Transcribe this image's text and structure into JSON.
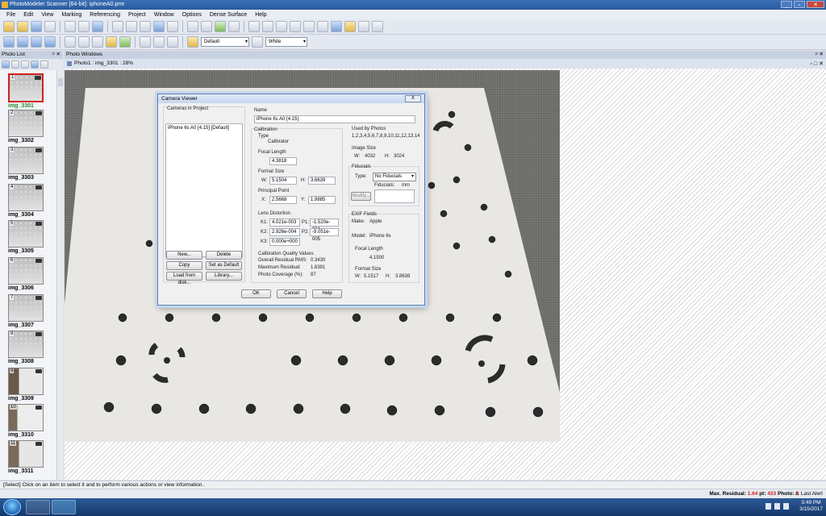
{
  "window": {
    "title": "PhotoModeler Scanner [64-bit]: iphoneA0.pmr",
    "buttons": [
      "_",
      "▫",
      "✕"
    ]
  },
  "menu": [
    "File",
    "Edit",
    "View",
    "Marking",
    "Referencing",
    "Project",
    "Window",
    "Options",
    "Dense Surface",
    "Help"
  ],
  "toolbar": {
    "display_select": "Default",
    "color_select": "White"
  },
  "photo_list": {
    "header": "Photo List",
    "items": [
      {
        "num": "1",
        "label": "img_3301",
        "selected": true
      },
      {
        "num": "2",
        "label": "img_3302"
      },
      {
        "num": "3",
        "label": "img_3303"
      },
      {
        "num": "4",
        "label": "img_3304"
      },
      {
        "num": "5",
        "label": "img_3305"
      },
      {
        "num": "6",
        "label": "img_3306"
      },
      {
        "num": "7",
        "label": "img_3307"
      },
      {
        "num": "8",
        "label": "img_3308"
      },
      {
        "num": "9",
        "label": "img_3309"
      },
      {
        "num": "10",
        "label": "img_3310"
      },
      {
        "num": "11",
        "label": "img_3311"
      }
    ]
  },
  "photo_windows": {
    "header": "Photo Windows",
    "tab": "Photo1 : img_3301 : 28%"
  },
  "camera_viewer": {
    "title": "Camera Viewer",
    "close": "X",
    "cameras_label": "Cameras in Project",
    "cameras": [
      "iPhone 6s A0 [4.15] [Default]"
    ],
    "buttons": {
      "new": "New...",
      "delete": "Delete",
      "copy": "Copy",
      "set_default": "Set as Default",
      "load": "Load from disk...",
      "library": "Library...",
      "ok": "OK",
      "cancel": "Cancel",
      "help": "Help"
    },
    "name_label": "Name",
    "name": "iPhone 6s A0 [4.15]",
    "calibration_label": "Calibration",
    "type_label": "Type",
    "type": "Calibrator",
    "focal_label": "Focal Length",
    "focal": "4.3818",
    "format_label": "Format Size",
    "w_label": "W:",
    "h_label": "H:",
    "format_w": "5.1504",
    "format_h": "3.6639",
    "pp_label": "Principal Point",
    "x_label": "X:",
    "y_label": "Y:",
    "pp_x": "2.5668",
    "pp_y": "1.9885",
    "lens_label": "Lens Distortion",
    "k1_label": "K1:",
    "k2_label": "K2:",
    "k3_label": "K3:",
    "p1_label": "P1:",
    "p2_label": "P2:",
    "k1": "4.021e-003",
    "k2": "2.926e-004",
    "k3": "0.000e+000",
    "p1": "-1.520e-004",
    "p2": "-9.051e-005",
    "quality_label": "Calibration Quality Values",
    "rms_label": "Overall Residual RMS:",
    "rms": "0.3430",
    "maxres_label": "Maximum Residual:",
    "maxres": "1.6391",
    "coverage_label": "Photo Coverage (%):",
    "coverage": "87",
    "used_label": "Used by Photos",
    "used": "1,2,3,4,5,6,7,8,9,10,11,12,13,14",
    "image_size_label": "Image Size",
    "img_w": "4032",
    "img_h": "3024",
    "fiducials_label": "Fiducials",
    "fid_type_label": "Type:",
    "fid_type": "No Fiducials",
    "fid_label": "Fiducials:",
    "fid_unit": "mm",
    "modify": "Modify...",
    "exif_label": "EXIF Fields",
    "make_label": "Make:",
    "make": "Apple",
    "model_label": "Model:",
    "model": "iPhone 6s",
    "exif_focal_label": "Focal Length",
    "exif_focal": "4.1500",
    "exif_format_label": "Format Size",
    "exif_w": "5.1517",
    "exif_h": "3.8638"
  },
  "status": {
    "hint": "[Select] Click on an item to select it and to perform various actions or view information.",
    "max_residual_label": "Max. Residual:",
    "max_residual": "1.64",
    "pt_label": "pt:",
    "pt": "433",
    "photo_label": "Photo:",
    "photo": "8",
    "last_alert": "Last Alert"
  },
  "taskbar": {
    "time": "3:49 PM",
    "date": "3/15/2017"
  },
  "colors": {
    "accent": "#2a5a9e",
    "selected_thumb_border": "#d02020",
    "selected_label": "#2a8a2a",
    "status_red": "#d01e1e"
  }
}
